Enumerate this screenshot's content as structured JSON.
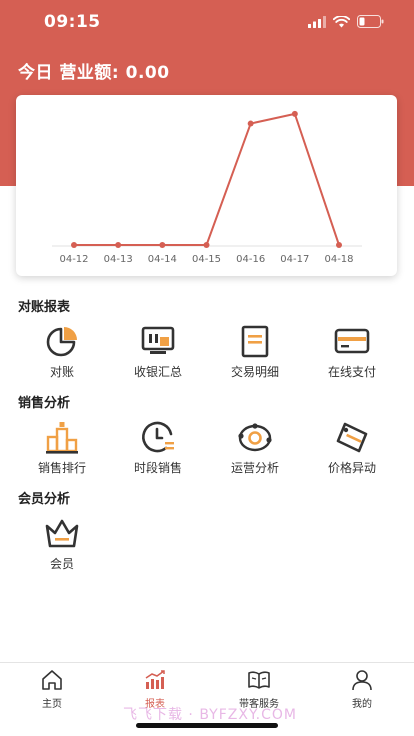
{
  "status": {
    "time": "09:15"
  },
  "revenue": {
    "title": "今日 营业额: 0.00"
  },
  "colors": {
    "brand": "#d55f53",
    "accent": "#f0a045",
    "icon_dark": "#333333"
  },
  "chart_data": {
    "type": "line",
    "categories": [
      "04-12",
      "04-13",
      "04-14",
      "04-15",
      "04-16",
      "04-17",
      "04-18"
    ],
    "values": [
      0,
      0,
      0,
      0,
      88,
      95,
      0
    ],
    "ylim": [
      0,
      100
    ],
    "grid": false,
    "title": "",
    "xlabel": "",
    "ylabel": ""
  },
  "sections": [
    {
      "title": "对账报表",
      "items": [
        {
          "label": "对账",
          "icon": "pie-chart-icon"
        },
        {
          "label": "收银汇总",
          "icon": "cash-register-icon"
        },
        {
          "label": "交易明细",
          "icon": "document-list-icon"
        },
        {
          "label": "在线支付",
          "icon": "credit-card-icon"
        }
      ]
    },
    {
      "title": "销售分析",
      "items": [
        {
          "label": "销售排行",
          "icon": "podium-icon"
        },
        {
          "label": "时段销售",
          "icon": "clock-icon"
        },
        {
          "label": "运营分析",
          "icon": "orbit-icon"
        },
        {
          "label": "价格异动",
          "icon": "price-tag-icon"
        }
      ]
    },
    {
      "title": "会员分析",
      "items": [
        {
          "label": "会员",
          "icon": "crown-icon"
        }
      ]
    }
  ],
  "tabs": [
    {
      "label": "主页",
      "icon": "home-icon"
    },
    {
      "label": "报表",
      "icon": "bar-chart-icon",
      "active": true
    },
    {
      "label": "带客服务",
      "icon": "book-icon"
    },
    {
      "label": "我的",
      "icon": "user-icon"
    }
  ],
  "watermark": "飞飞下载 · BYFZXY.COM"
}
